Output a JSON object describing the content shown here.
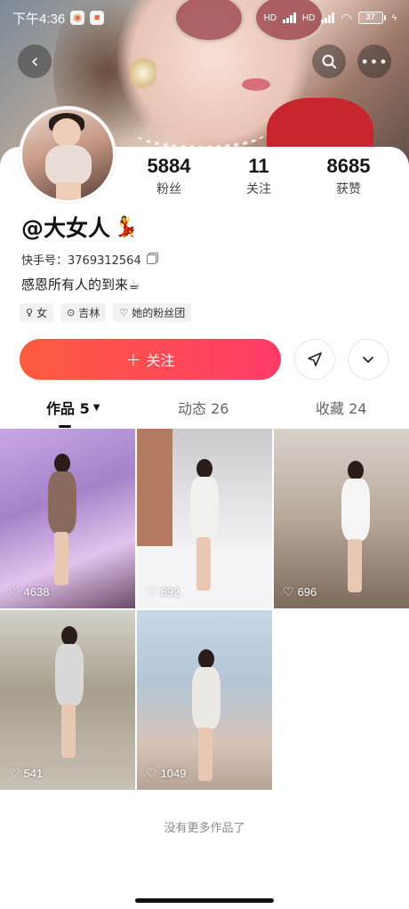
{
  "status_bar": {
    "time": "下午4:36",
    "battery": "37"
  },
  "profile": {
    "fans_count": "5884",
    "fans_label": "粉丝",
    "following_count": "11",
    "following_label": "关注",
    "likes_count": "8685",
    "likes_label": "获赞",
    "nickname": "@大女人",
    "nickname_emoji": "💃",
    "kuaishou_id": "快手号：3769312564",
    "bio": "感恩所有人的到来☕",
    "tags": {
      "gender": "女",
      "location": "吉林",
      "fan_group": "她的粉丝团"
    }
  },
  "actions": {
    "follow_label": "关注"
  },
  "tabs": {
    "works": "作品 5",
    "moments": "动态 26",
    "collections": "收藏 24"
  },
  "videos": [
    {
      "likes": "4638"
    },
    {
      "likes": "892"
    },
    {
      "likes": "696"
    },
    {
      "likes": "541"
    },
    {
      "likes": "1049"
    }
  ],
  "footer": {
    "no_more": "没有更多作品了"
  },
  "icons": {
    "back": "back-arrow-icon",
    "search": "search-icon",
    "more": "more-icon",
    "share": "share-icon",
    "expand": "chevron-down-icon",
    "heart": "heart-icon"
  },
  "colors": {
    "follow_button_start": "#fd5c3f",
    "follow_button_end": "#fe3c68"
  }
}
